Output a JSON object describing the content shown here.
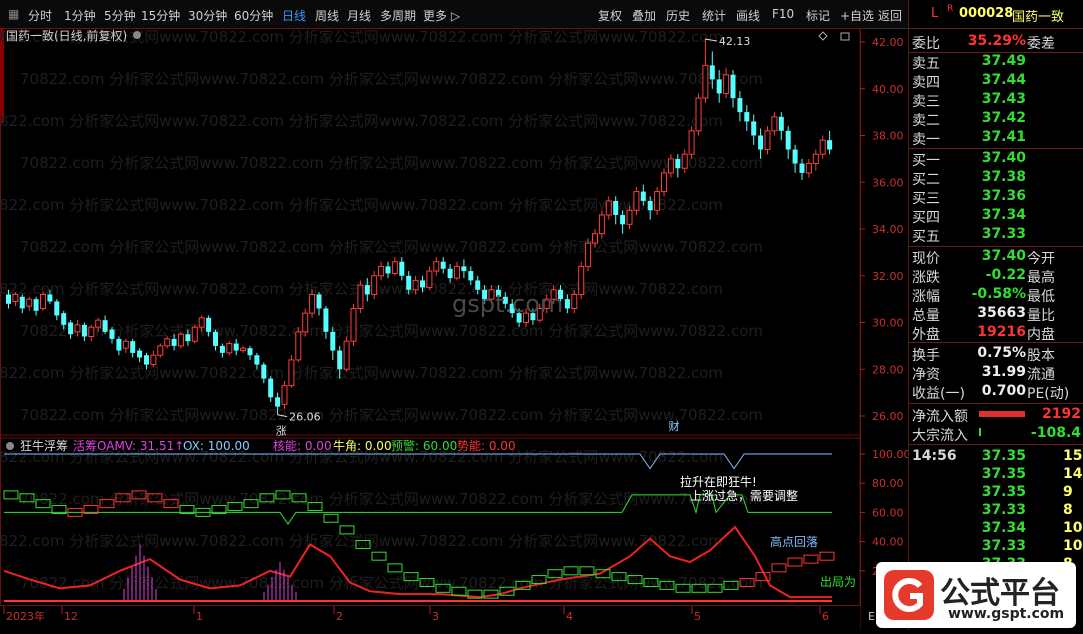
{
  "toolbar": {
    "periods": [
      "分时",
      "1分钟",
      "5分钟",
      "15分钟",
      "30分钟",
      "60分钟",
      "日线",
      "周线",
      "月线",
      "多周期",
      "更多 ▷"
    ],
    "active_period": "日线",
    "actions": [
      "复权",
      "叠加",
      "历史",
      "统计",
      "画线",
      "F10",
      "标记",
      "+自选",
      "返回"
    ]
  },
  "chart": {
    "title": "国药一致(日线,前复权)",
    "price_ticks": [
      "42.00",
      "40.00",
      "38.00",
      "36.00",
      "34.00",
      "32.00",
      "30.00",
      "28.00",
      "26.00"
    ],
    "high_label": "42.13",
    "low_label": "26.06",
    "mark_zhang": "涨",
    "mark_cai": "财",
    "watermark": "gspt.com",
    "bg_watermark": "70822.com 分析家公式网www.70822.com 分析家公式网www.70822.com 分析家公式网www.70822.com"
  },
  "indicator": {
    "name": "狂牛浮筹",
    "items": [
      {
        "text": "活筹OAMV: 31.51↑",
        "color": "#dd44dd"
      },
      {
        "text": "OX: 100.00",
        "color": "#88ccff"
      },
      {
        "text": "核能: 0.00",
        "color": "#dd44dd"
      },
      {
        "text": "牛角: 0.00",
        "color": "#ffff66"
      },
      {
        "text": "预警: 60.00",
        "color": "#33dd33"
      },
      {
        "text": "势能: 0.00",
        "color": "#ff3333"
      }
    ],
    "ticks": [
      "100.00",
      "80.00",
      "60.00",
      "40.00",
      "20.00"
    ],
    "notes": {
      "lasheng": "拉升在即狂牛!",
      "shangzhang": "上涨过急，需要调整",
      "gaodian": "高点回落",
      "chuju": "出局为"
    }
  },
  "xaxis": {
    "labels": [
      "2023年",
      "12",
      "1",
      "2",
      "3",
      "4",
      "5",
      "6"
    ],
    "last": "E"
  },
  "quote": {
    "code_prefix": "L",
    "code_r": "R",
    "code": "000028",
    "name": "国药一致",
    "weibi_label": "委比",
    "weibi": "35.29%",
    "weicha_label": "委差",
    "sell": [
      {
        "label": "卖五",
        "price": "37.49"
      },
      {
        "label": "卖四",
        "price": "37.44"
      },
      {
        "label": "卖三",
        "price": "37.43"
      },
      {
        "label": "卖二",
        "price": "37.42"
      },
      {
        "label": "卖一",
        "price": "37.41"
      }
    ],
    "buy": [
      {
        "label": "买一",
        "price": "37.40"
      },
      {
        "label": "买二",
        "price": "37.38"
      },
      {
        "label": "买三",
        "price": "37.36"
      },
      {
        "label": "买四",
        "price": "37.34"
      },
      {
        "label": "买五",
        "price": "37.33"
      }
    ],
    "stats": [
      {
        "l": "现价",
        "v": "37.40",
        "c": "green",
        "r": "今开"
      },
      {
        "l": "涨跌",
        "v": "-0.22",
        "c": "green",
        "r": "最高"
      },
      {
        "l": "涨幅",
        "v": "-0.58%",
        "c": "green",
        "r": "最低"
      },
      {
        "l": "总量",
        "v": "35663",
        "c": "white",
        "r": "量比"
      },
      {
        "l": "外盘",
        "v": "19216",
        "c": "red",
        "r": "内盘"
      }
    ],
    "stats2": [
      {
        "l": "换手",
        "v": "0.75%",
        "c": "white",
        "r": "股本"
      },
      {
        "l": "净资",
        "v": "31.99",
        "c": "white",
        "r": "流通"
      },
      {
        "l": "收益(一)",
        "v": "0.700",
        "c": "white",
        "r": "PE(动)"
      }
    ],
    "flow": [
      {
        "l": "净流入额",
        "v": "2192",
        "c": "red"
      },
      {
        "l": "大宗流入",
        "v": "-108.4",
        "c": "green"
      }
    ],
    "ticks": [
      {
        "time": "14:56",
        "price": "37.35",
        "vol": "15"
      },
      {
        "time": "",
        "price": "37.35",
        "vol": "14"
      },
      {
        "time": "",
        "price": "37.35",
        "vol": "9"
      },
      {
        "time": "",
        "price": "37.33",
        "vol": "8"
      },
      {
        "time": "",
        "price": "37.34",
        "vol": "10"
      },
      {
        "time": "",
        "price": "37.33",
        "vol": "10"
      },
      {
        "time": "",
        "price": "37.33",
        "vol": "8"
      }
    ]
  },
  "logo": {
    "text": "公式平台",
    "url": "www.gspt.com"
  }
}
